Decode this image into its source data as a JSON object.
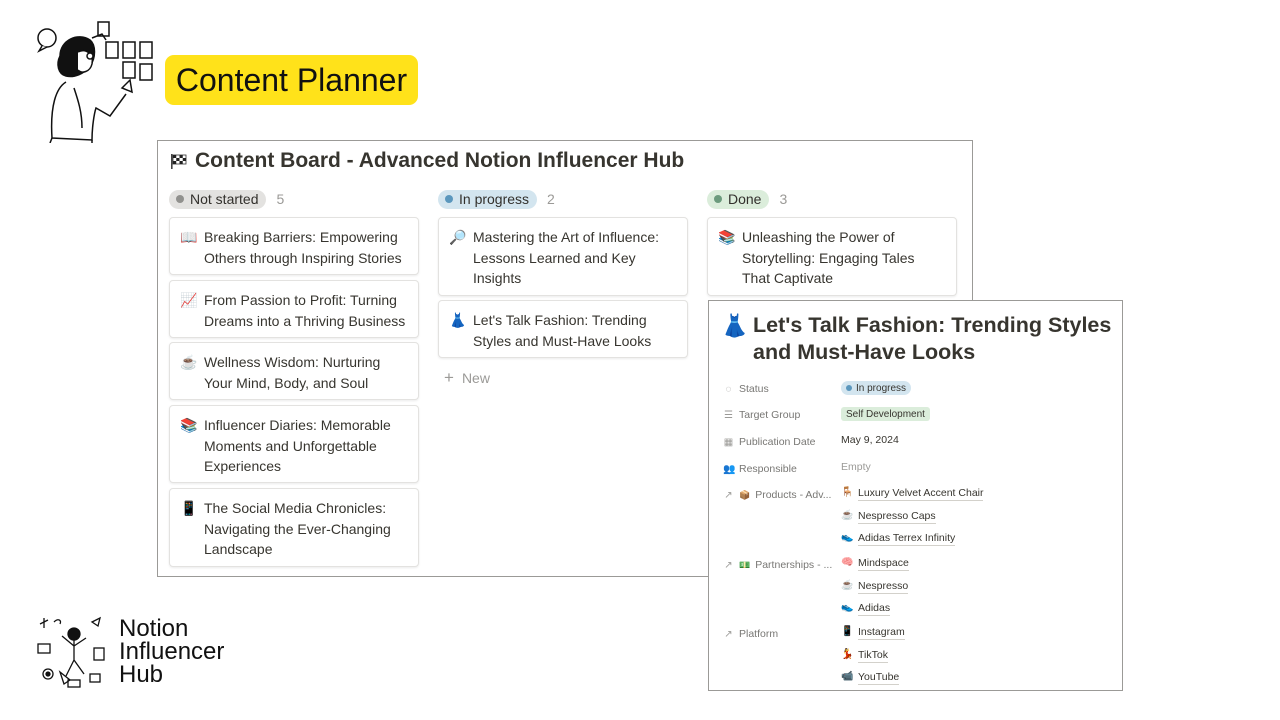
{
  "header": {
    "title": "Content Planner"
  },
  "board": {
    "title": "Content Board - Advanced Notion Influencer Hub",
    "columns": [
      {
        "status": "Not started",
        "count": "5",
        "color": "#e3e2e0",
        "dot": "#91918e",
        "cards": [
          {
            "emoji": "📖",
            "text": "Breaking Barriers: Empowering Others through Inspiring Stories"
          },
          {
            "emoji": "📈",
            "text": "From Passion to Profit: Turning Dreams into a Thriving Business"
          },
          {
            "emoji": "☕",
            "text": "Wellness Wisdom: Nurturing Your Mind, Body, and Soul"
          },
          {
            "emoji": "📚",
            "text": "Influencer Diaries: Memorable Moments and Unforgettable Experiences"
          },
          {
            "emoji": "📱",
            "text": "The Social Media Chronicles: Navigating the Ever-Changing Landscape"
          }
        ]
      },
      {
        "status": "In progress",
        "count": "2",
        "color": "#d3e5ef",
        "dot": "#5b97bd",
        "cards": [
          {
            "emoji": "🔎",
            "text": "Mastering the Art of Influence: Lessons Learned and Key Insights"
          },
          {
            "emoji": "👗",
            "text": "Let's Talk Fashion: Trending Styles and Must-Have Looks"
          }
        ],
        "new_label": "New"
      },
      {
        "status": "Done",
        "count": "3",
        "color": "#dbeddb",
        "dot": "#6c9b7d",
        "cards": [
          {
            "emoji": "📚",
            "text": "Unleashing the Power of Storytelling: Engaging Tales That Captivate"
          }
        ]
      }
    ]
  },
  "detail": {
    "emoji": "👗",
    "title": "Let's Talk Fashion: Trending Styles and Must-Have Looks",
    "props": {
      "status": {
        "label": "Status",
        "value": "In progress"
      },
      "target": {
        "label": "Target Group",
        "value": "Self Development"
      },
      "date": {
        "label": "Publication Date",
        "value": "May 9, 2024"
      },
      "responsible": {
        "label": "Responsible",
        "value": "Empty"
      },
      "products": {
        "label": "Products - Adv...",
        "items": [
          {
            "emoji": "🪑",
            "text": "Luxury Velvet Accent Chair"
          },
          {
            "emoji": "☕",
            "text": "Nespresso Caps"
          },
          {
            "emoji": "👟",
            "text": "Adidas Terrex Infinity"
          }
        ]
      },
      "partnerships": {
        "label": "Partnerships - ...",
        "items": [
          {
            "emoji": "🧠",
            "text": "Mindspace"
          },
          {
            "emoji": "☕",
            "text": "Nespresso"
          },
          {
            "emoji": "👟",
            "text": "Adidas"
          }
        ]
      },
      "platform": {
        "label": "Platform",
        "items": [
          {
            "emoji": "📱",
            "text": "Instagram"
          },
          {
            "emoji": "💃",
            "text": "TikTok"
          },
          {
            "emoji": "📹",
            "text": "YouTube"
          }
        ]
      }
    }
  },
  "brand": {
    "line1": "Notion",
    "line2": "Influencer",
    "line3": "Hub"
  },
  "colors": {
    "accent_yellow": "#ffe21a",
    "text": "#37352f",
    "muted": "#9b9a97"
  },
  "icons": [
    "board-flag-icon",
    "plus-icon",
    "status-icon",
    "list-icon",
    "calendar-icon",
    "people-icon",
    "relation-arrow-icon"
  ]
}
